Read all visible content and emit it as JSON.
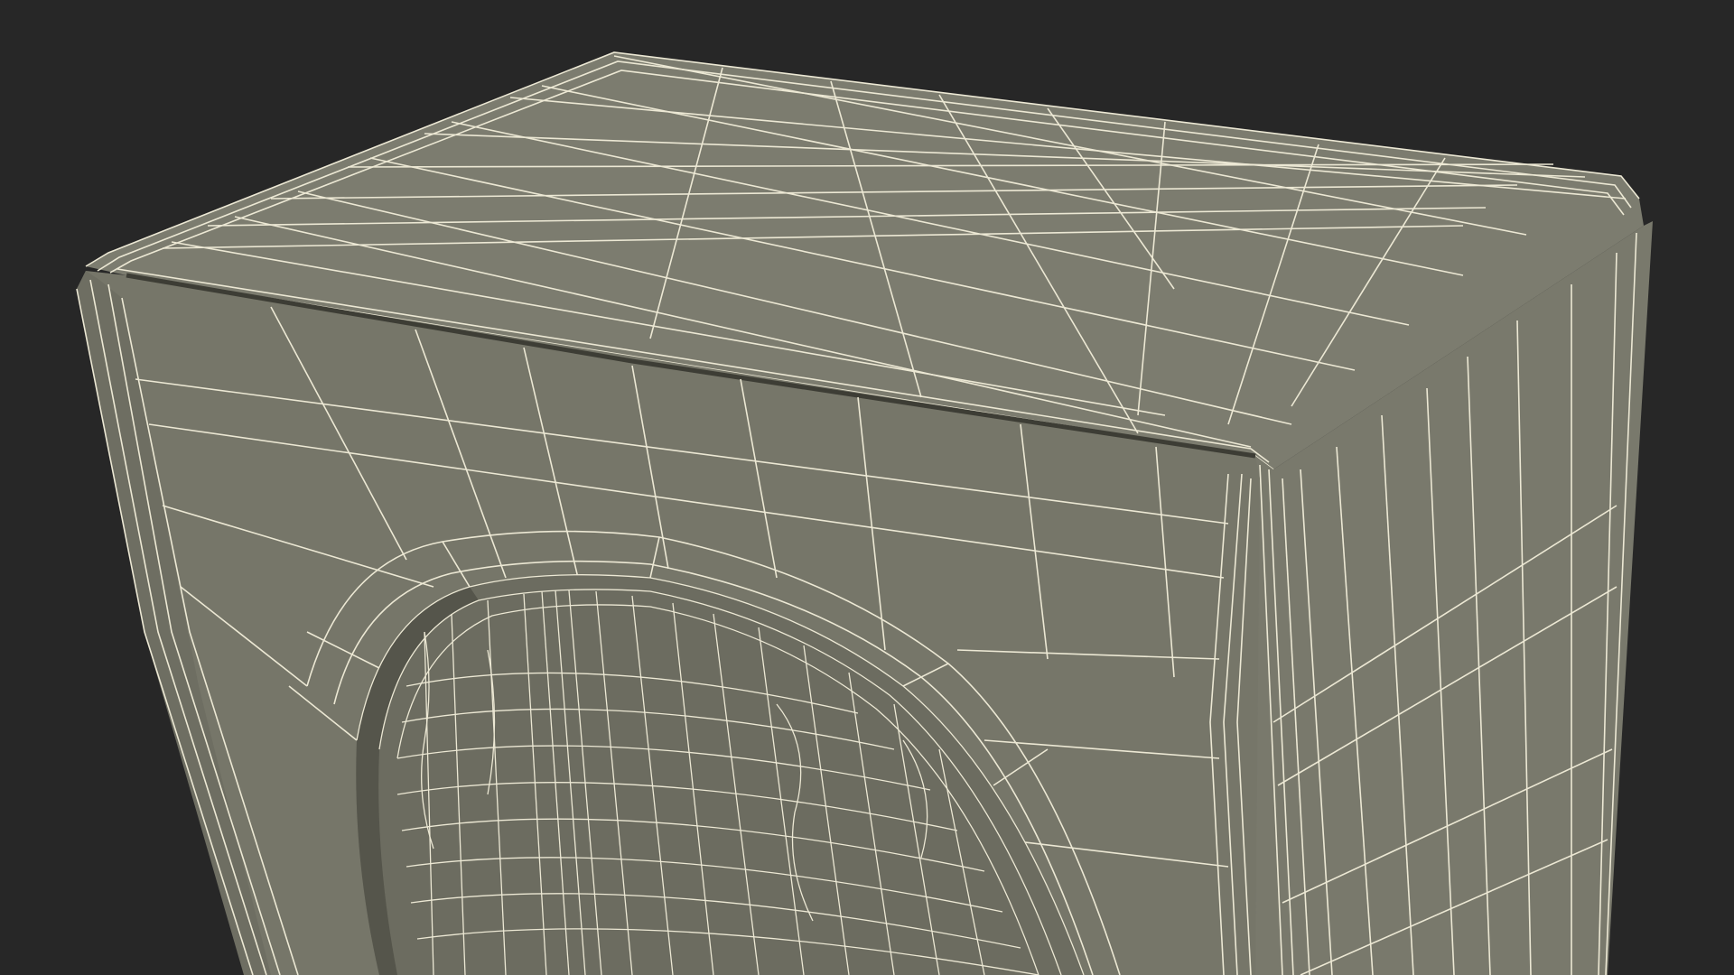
{
  "scene": {
    "subject": "wireframe-3d-model",
    "colors": {
      "background": "#272727",
      "surface_top": "#7c7c6f",
      "surface_front": "#767669",
      "surface_side": "#79796c",
      "surface_drum": "#6c6c60",
      "shadow": "#5b5b50",
      "wire": "#ece8d4"
    }
  }
}
